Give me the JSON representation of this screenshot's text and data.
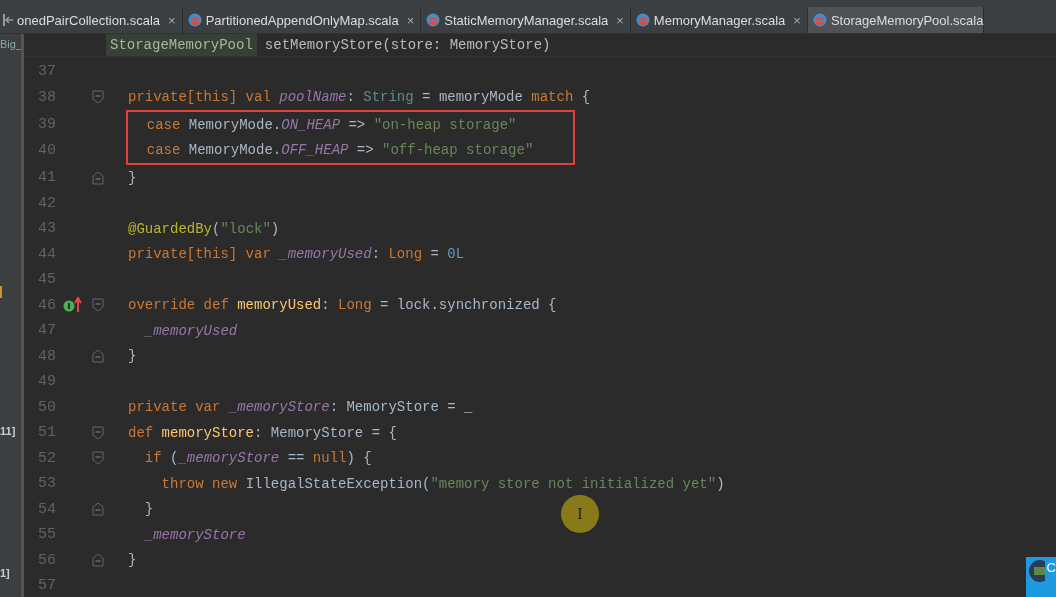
{
  "project_panel": {
    "items": [
      {
        "text": "Big_",
        "kind": "label"
      },
      {
        "kind": "mark"
      },
      {
        "text": "11]",
        "kind": "label"
      },
      {
        "text": "1]",
        "kind": "label"
      }
    ]
  },
  "tabs": [
    {
      "label": "onedPairCollection.scala",
      "selected": false,
      "kind": "clipped"
    },
    {
      "label": "PartitionedAppendOnlyMap.scala",
      "selected": false,
      "kind": "file"
    },
    {
      "label": "StaticMemoryManager.scala",
      "selected": false,
      "kind": "file"
    },
    {
      "label": "MemoryManager.scala",
      "selected": false,
      "kind": "file"
    },
    {
      "label": "StorageMemoryPool.scala",
      "selected": true,
      "kind": "file"
    }
  ],
  "close_glyph": "×",
  "breadcrumbs": [
    {
      "label": "StorageMemoryPool",
      "selected": true
    },
    {
      "label": "setMemoryStore(store: MemoryStore)",
      "selected": false
    }
  ],
  "editor": {
    "lines": [
      {
        "kind": "line",
        "number": "37"
      },
      {
        "kind": "line",
        "number": "38",
        "markers": [
          {
            "kind": "fold_start"
          }
        ],
        "tokens": [
          {
            "text": "private[this] val ",
            "kind": "kw"
          },
          {
            "text": "poolName",
            "kind": "field"
          },
          {
            "text": ": ",
            "kind": "plain"
          },
          {
            "text": "String",
            "kind": "type"
          },
          {
            "text": " = memoryMode ",
            "kind": "plain"
          },
          {
            "text": "match",
            "kind": "kw"
          },
          {
            "text": " {",
            "kind": "plain"
          }
        ]
      },
      {
        "kind": "highlight_box",
        "lines": [
          {
            "kind": "line",
            "number": "39",
            "tokens": [
              {
                "text": "  case ",
                "kind": "kw"
              },
              {
                "text": "MemoryMode.",
                "kind": "plain"
              },
              {
                "text": "ON_HEAP",
                "kind": "field"
              },
              {
                "text": " => ",
                "kind": "plain"
              },
              {
                "text": "\"on-heap storage\"",
                "kind": "str"
              }
            ]
          },
          {
            "kind": "line",
            "number": "40",
            "tokens": [
              {
                "text": "  case ",
                "kind": "kw"
              },
              {
                "text": "MemoryMode.",
                "kind": "plain"
              },
              {
                "text": "OFF_HEAP",
                "kind": "field"
              },
              {
                "text": " => ",
                "kind": "plain"
              },
              {
                "text": "\"off-heap storage\"",
                "kind": "str"
              }
            ]
          }
        ]
      },
      {
        "kind": "line",
        "number": "41",
        "markers": [
          {
            "kind": "fold_end"
          }
        ],
        "tokens": [
          {
            "text": "}",
            "kind": "plain"
          }
        ]
      },
      {
        "kind": "line",
        "number": "42"
      },
      {
        "kind": "line",
        "number": "43",
        "tokens": [
          {
            "text": "@GuardedBy",
            "kind": "anno"
          },
          {
            "text": "(",
            "kind": "plain"
          },
          {
            "text": "\"lock\"",
            "kind": "str"
          },
          {
            "text": ")",
            "kind": "plain"
          }
        ]
      },
      {
        "kind": "line",
        "number": "44",
        "tokens": [
          {
            "text": "private[this] var ",
            "kind": "kw"
          },
          {
            "text": "_memoryUsed",
            "kind": "field"
          },
          {
            "text": ": ",
            "kind": "plain"
          },
          {
            "text": "Long",
            "kind": "kw"
          },
          {
            "text": " = ",
            "kind": "plain"
          },
          {
            "text": "0L",
            "kind": "num"
          }
        ]
      },
      {
        "kind": "line",
        "number": "45"
      },
      {
        "kind": "line",
        "number": "46",
        "markers": [
          {
            "kind": "override"
          },
          {
            "kind": "fold_start"
          }
        ],
        "tokens": [
          {
            "text": "override def ",
            "kind": "kw"
          },
          {
            "text": "memoryUsed",
            "kind": "decl"
          },
          {
            "text": ": ",
            "kind": "plain"
          },
          {
            "text": "Long",
            "kind": "kw"
          },
          {
            "text": " = lock.synchronized {",
            "kind": "plain"
          }
        ]
      },
      {
        "kind": "line",
        "number": "47",
        "tokens": [
          {
            "text": "  _memoryUsed",
            "kind": "field"
          }
        ]
      },
      {
        "kind": "line",
        "number": "48",
        "markers": [
          {
            "kind": "fold_end"
          }
        ],
        "tokens": [
          {
            "text": "}",
            "kind": "plain"
          }
        ]
      },
      {
        "kind": "line",
        "number": "49"
      },
      {
        "kind": "line",
        "number": "50",
        "tokens": [
          {
            "text": "private var ",
            "kind": "kw"
          },
          {
            "text": "_memoryStore",
            "kind": "field"
          },
          {
            "text": ": MemoryStore = _",
            "kind": "plain"
          }
        ]
      },
      {
        "kind": "line",
        "number": "51",
        "markers": [
          {
            "kind": "fold_start"
          }
        ],
        "tokens": [
          {
            "text": "def ",
            "kind": "kw"
          },
          {
            "text": "memoryStore",
            "kind": "decl"
          },
          {
            "text": ": MemoryStore = {",
            "kind": "plain"
          }
        ]
      },
      {
        "kind": "line",
        "number": "52",
        "markers": [
          {
            "kind": "fold_start"
          }
        ],
        "tokens": [
          {
            "text": "  if ",
            "kind": "kw"
          },
          {
            "text": "(",
            "kind": "plain"
          },
          {
            "text": "_memoryStore",
            "kind": "field"
          },
          {
            "text": " == ",
            "kind": "plain"
          },
          {
            "text": "null",
            "kind": "kw"
          },
          {
            "text": ") {",
            "kind": "plain"
          }
        ]
      },
      {
        "kind": "line",
        "number": "53",
        "tokens": [
          {
            "text": "    throw new ",
            "kind": "kw"
          },
          {
            "text": "IllegalStateException(",
            "kind": "plain"
          },
          {
            "text": "\"memory store not initialized yet\"",
            "kind": "str"
          },
          {
            "text": ")",
            "kind": "plain"
          }
        ]
      },
      {
        "kind": "line",
        "number": "54",
        "markers": [
          {
            "kind": "fold_end"
          }
        ],
        "tokens": [
          {
            "text": "  }",
            "kind": "plain"
          }
        ]
      },
      {
        "kind": "line",
        "number": "55",
        "tokens": [
          {
            "text": "  _memoryStore",
            "kind": "field"
          }
        ]
      },
      {
        "kind": "line",
        "number": "56",
        "markers": [
          {
            "kind": "fold_end"
          }
        ],
        "tokens": [
          {
            "text": "}",
            "kind": "plain"
          }
        ]
      },
      {
        "kind": "line",
        "number": "57"
      }
    ]
  },
  "cursor_glyph": "I",
  "notification": {
    "text": "C"
  }
}
